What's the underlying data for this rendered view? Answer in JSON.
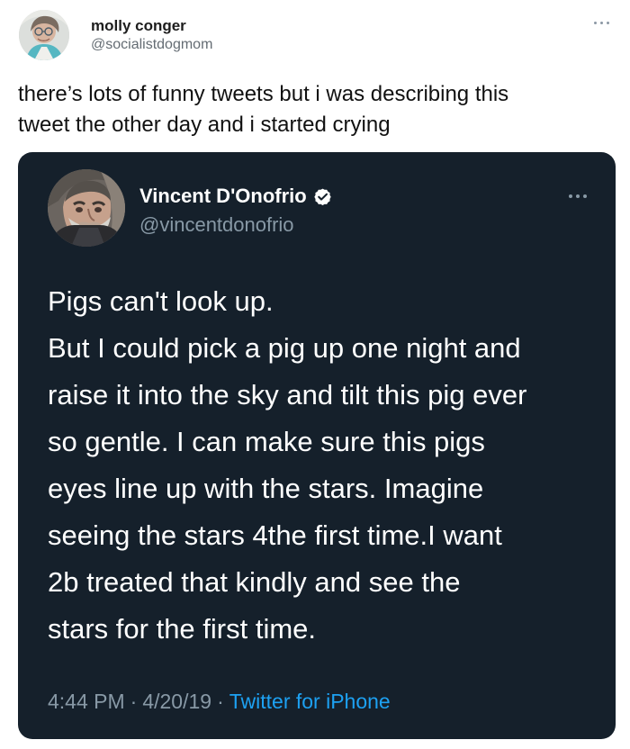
{
  "tweet": {
    "author": {
      "display_name": "molly conger",
      "username": "@socialistdogmom",
      "avatar": "avatar-image"
    },
    "menu_icon": "more-horizontal-icon",
    "text": "there’s lots of funny tweets but i was describing this\ntweet the other day and i started crying"
  },
  "quoted_tweet": {
    "author": {
      "display_name": "Vincent D'Onofrio",
      "username": "@vincentdonofrio",
      "avatar": "avatar-image",
      "verified_icon": "verified-badge-icon"
    },
    "menu_icon": "more-horizontal-icon",
    "text": "Pigs can't look up.\nBut I could pick a pig up one night and\nraise it into the sky and tilt this pig ever\nso gentle. I can make sure this pigs\neyes line up with the stars. Imagine\nseeing the stars 4the first time.I want\n2b treated that kindly and see the\nstars for the first time.",
    "time": "4:44 PM",
    "date": "4/20/19",
    "separator": "·",
    "source": "Twitter for iPhone"
  },
  "colors": {
    "quoted_background": "#15202b",
    "accent_blue": "#1da1f2",
    "muted_gray": "#8899a6",
    "text_dark": "#111111"
  }
}
